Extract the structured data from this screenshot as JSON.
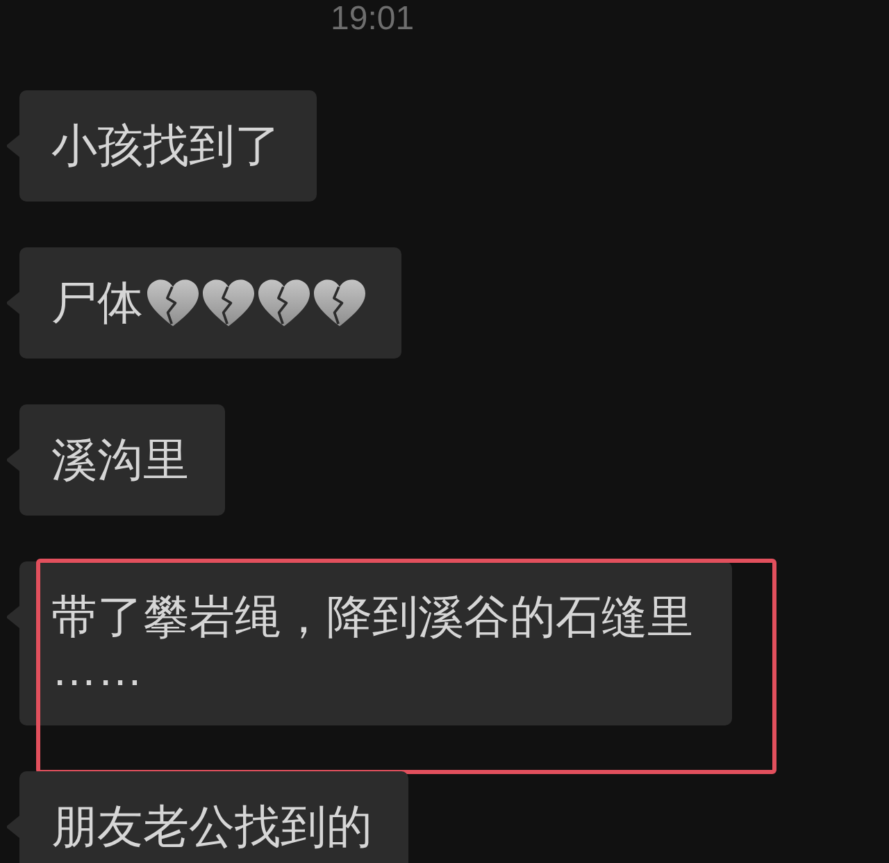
{
  "timestamp": "19:01",
  "messages": [
    {
      "text": "小孩找到了",
      "highlighted": false
    },
    {
      "text": "尸体",
      "emojis": [
        {
          "kind": "broken_heart"
        },
        {
          "kind": "broken_heart"
        },
        {
          "kind": "broken_heart"
        },
        {
          "kind": "broken_heart"
        }
      ],
      "highlighted": false
    },
    {
      "text": "溪沟里",
      "highlighted": false
    },
    {
      "text": "带了攀岩绳，降到溪谷的石缝里……",
      "highlighted": true
    },
    {
      "text": "朋友老公找到的",
      "highlighted": false
    }
  ]
}
